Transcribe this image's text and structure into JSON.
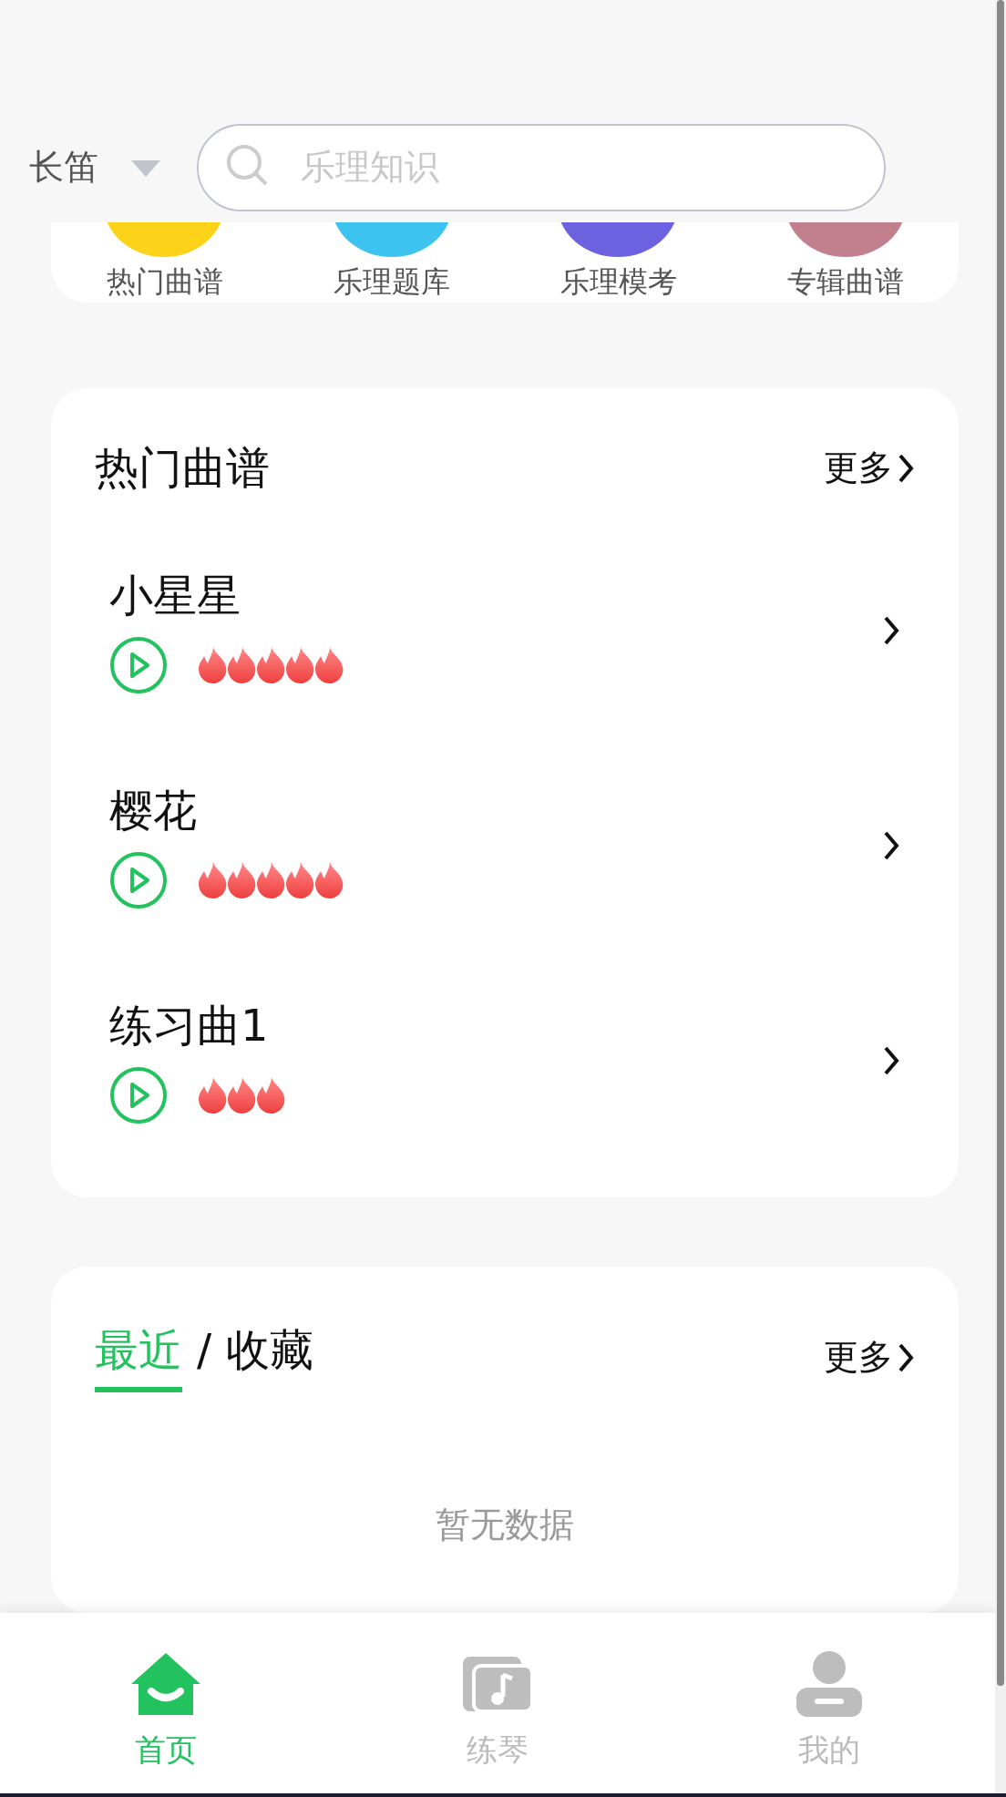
{
  "header": {
    "instrument": "长笛",
    "search": {
      "placeholder": "乐理知识"
    }
  },
  "categories": [
    {
      "label": "热门曲谱",
      "color": "#fcd319"
    },
    {
      "label": "乐理题库",
      "color": "#3cc3f0"
    },
    {
      "label": "乐理模考",
      "color": "#6c62e0"
    },
    {
      "label": "专辑曲谱",
      "color": "#c2808f"
    }
  ],
  "hot": {
    "title": "热门曲谱",
    "more": "更多",
    "items": [
      {
        "name": "小星星",
        "stars": 5
      },
      {
        "name": "樱花",
        "stars": 5
      },
      {
        "name": "练习曲1",
        "stars": 3
      }
    ]
  },
  "recent": {
    "tabs": [
      {
        "label": "最近",
        "selected": true
      },
      {
        "label": "收藏",
        "selected": false
      }
    ],
    "separator": "/",
    "more": "更多",
    "empty": "暂无数据"
  },
  "nav": [
    {
      "label": "首页",
      "kind": "home",
      "selected": true
    },
    {
      "label": "练琴",
      "kind": "practice",
      "selected": false
    },
    {
      "label": "我的",
      "kind": "profile",
      "selected": false
    }
  ]
}
